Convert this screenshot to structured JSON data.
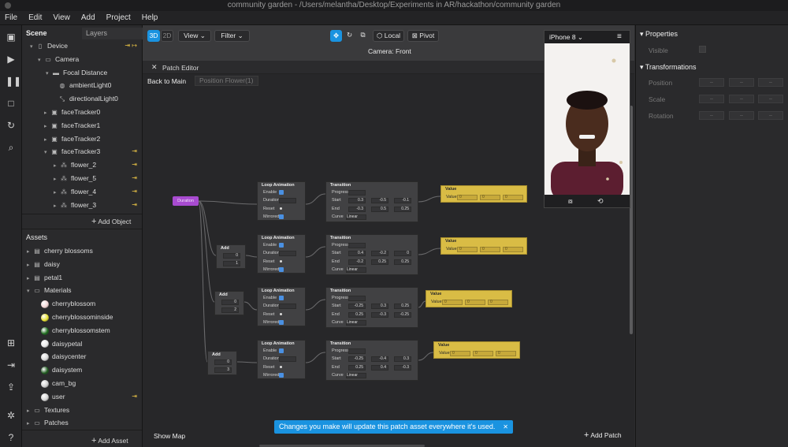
{
  "window": {
    "title": "community garden - /Users/melantha/Desktop/Experiments in AR/hackathon/community garden"
  },
  "menu": [
    "File",
    "Edit",
    "View",
    "Add",
    "Project",
    "Help"
  ],
  "scene": {
    "tab_scene": "Scene",
    "tab_layers": "Layers",
    "tree": [
      {
        "label": "Device",
        "icon": "device-icon",
        "arrow": "▾"
      },
      {
        "label": "Camera",
        "icon": "camera-icon",
        "arrow": "▾"
      },
      {
        "label": "Focal Distance",
        "icon": "focal-distance-icon",
        "arrow": "▾"
      },
      {
        "label": "ambientLight0",
        "icon": "ambient-light-icon",
        "arrow": ""
      },
      {
        "label": "directionalLight0",
        "icon": "directional-light-icon",
        "arrow": ""
      },
      {
        "label": "faceTracker0",
        "icon": "face-tracker-icon",
        "arrow": "▸"
      },
      {
        "label": "faceTracker1",
        "icon": "face-tracker-icon",
        "arrow": "▸"
      },
      {
        "label": "faceTracker2",
        "icon": "face-tracker-icon",
        "arrow": "▸"
      },
      {
        "label": "faceTracker3",
        "icon": "face-tracker-icon",
        "arrow": "▾"
      },
      {
        "label": "flower_2",
        "icon": "object-icon",
        "arrow": "▸"
      },
      {
        "label": "flower_5",
        "icon": "object-icon",
        "arrow": "▸"
      },
      {
        "label": "flower_4",
        "icon": "object-icon",
        "arrow": "▸"
      },
      {
        "label": "flower_3",
        "icon": "object-icon",
        "arrow": "▸"
      }
    ],
    "add_object": "Add Object"
  },
  "assets": {
    "title": "Assets",
    "items": [
      {
        "label": "cherry blossoms",
        "type": "file"
      },
      {
        "label": "daisy",
        "type": "file"
      },
      {
        "label": "petal1",
        "type": "file"
      },
      {
        "label": "Materials",
        "type": "folder"
      }
    ],
    "materials": [
      {
        "label": "cherryblossom",
        "color": "#f3d6d6"
      },
      {
        "label": "cherryblossominside",
        "color": "#e6e032"
      },
      {
        "label": "cherryblossomstem",
        "color": "#1e6b1e"
      },
      {
        "label": "daisypetal",
        "color": "#e8e8e8"
      },
      {
        "label": "daisycenter",
        "color": "#d8d8d8"
      },
      {
        "label": "daisystem",
        "color": "#1f5a1f"
      },
      {
        "label": "cam_bg",
        "color": "#cfcfcf"
      },
      {
        "label": "user",
        "color": "#d4d4d4"
      }
    ],
    "folders": [
      "Textures",
      "Patches"
    ],
    "add_asset": "Add Asset"
  },
  "viewport": {
    "mode_3d": "3D",
    "mode_2d": "2D",
    "view": "View",
    "filter": "Filter",
    "local": "Local",
    "pivot": "Pivot",
    "camera_label": "Camera: Front"
  },
  "patch_editor": {
    "title": "Patch Editor",
    "back": "Back to Main",
    "crumb": "Position Flower(1)",
    "show_map": "Show Map",
    "add_patch": "Add Patch",
    "duration_node": "Duration",
    "add_label": "Add",
    "loop": {
      "title": "Loop Animation",
      "enable": "Enable",
      "duration": "Duration",
      "reset": "Reset",
      "mirrored": "Mirrored"
    },
    "transition": {
      "title": "Transition",
      "progress": "Progress",
      "start": "Start",
      "end": "End",
      "curve": "Curve",
      "curve_value": "Linear"
    },
    "value": {
      "title": "Value",
      "port": "Value",
      "slot": "0"
    },
    "groups": [
      {
        "start": [
          "0.3",
          "-0.5",
          "-0.1"
        ],
        "end": [
          "-0.3",
          "0.5",
          "0.25"
        ],
        "add": null
      },
      {
        "start": [
          "0.4",
          "-0.2",
          "0"
        ],
        "end": [
          "-0.2",
          "0.25",
          "0.25"
        ],
        "add": [
          "0",
          "1"
        ]
      },
      {
        "start": [
          "-0.25",
          "0.3",
          "0.25"
        ],
        "end": [
          "0.25",
          "-0.3",
          "-0.25"
        ],
        "add": [
          "0",
          "2"
        ]
      },
      {
        "start": [
          "-0.25",
          "-0.4",
          "0.3"
        ],
        "end": [
          "0.25",
          "0.4",
          "-0.3"
        ],
        "add": [
          "0",
          "3"
        ]
      }
    ]
  },
  "toast": "Changes you make will update this patch asset everywhere it's used.",
  "preview": {
    "device": "iPhone 8"
  },
  "properties": {
    "title": "Properties",
    "visible": "Visible",
    "transformations": "Transformations",
    "position": "Position",
    "scale": "Scale",
    "rotation": "Rotation",
    "dash": "–"
  },
  "colors": {
    "accent": "#1a93e0",
    "value_node": "#d9bc45",
    "duration_node": "#a84bd0"
  }
}
